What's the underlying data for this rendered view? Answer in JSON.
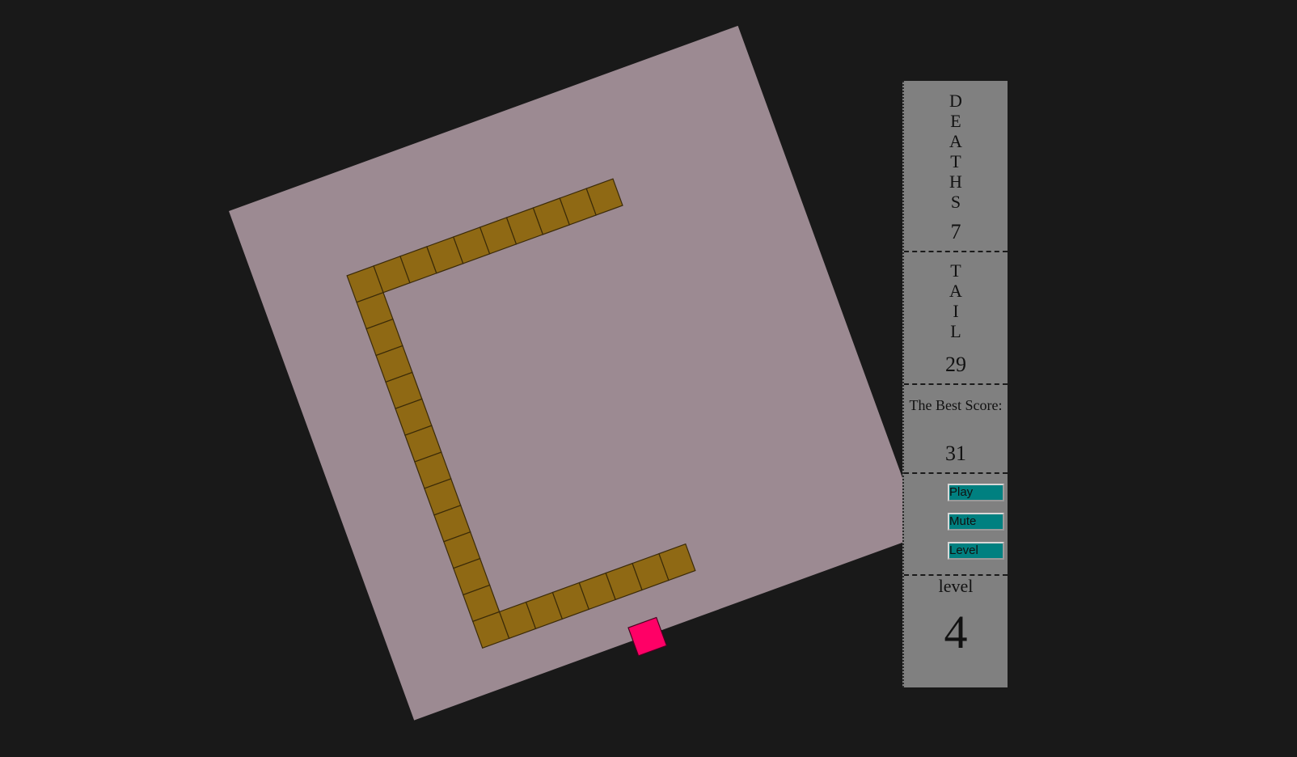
{
  "stats": {
    "deaths_label": "DEATHS",
    "deaths_value": "7",
    "tail_label": "TAIL",
    "tail_value": "29",
    "best_label": "The Best Score:",
    "best_value": "31",
    "level_label": "level",
    "level_value": "4"
  },
  "buttons": {
    "play": "Play",
    "mute": "Mute",
    "level": "Level"
  },
  "game": {
    "board_color": "#9c8a92",
    "snake_color": "#8f6914",
    "food_color": "#ff0066",
    "background_color": "#191919",
    "rotation_deg": -20,
    "snake_cells": [
      [
        9,
        0
      ],
      [
        8,
        0
      ],
      [
        7,
        0
      ],
      [
        6,
        0
      ],
      [
        5,
        0
      ],
      [
        4,
        0
      ],
      [
        3,
        0
      ],
      [
        2,
        0
      ],
      [
        1,
        0
      ],
      [
        0,
        0
      ],
      [
        0,
        1
      ],
      [
        0,
        2
      ],
      [
        0,
        3
      ],
      [
        0,
        4
      ],
      [
        0,
        5
      ],
      [
        0,
        6
      ],
      [
        0,
        7
      ],
      [
        0,
        8
      ],
      [
        0,
        9
      ],
      [
        0,
        10
      ],
      [
        0,
        11
      ],
      [
        0,
        12
      ],
      [
        0,
        13
      ],
      [
        1,
        13
      ],
      [
        2,
        13
      ],
      [
        3,
        13
      ],
      [
        4,
        13
      ],
      [
        5,
        13
      ],
      [
        6,
        13
      ],
      [
        7,
        13
      ]
    ],
    "food_cell": [
      5,
      15
    ]
  }
}
